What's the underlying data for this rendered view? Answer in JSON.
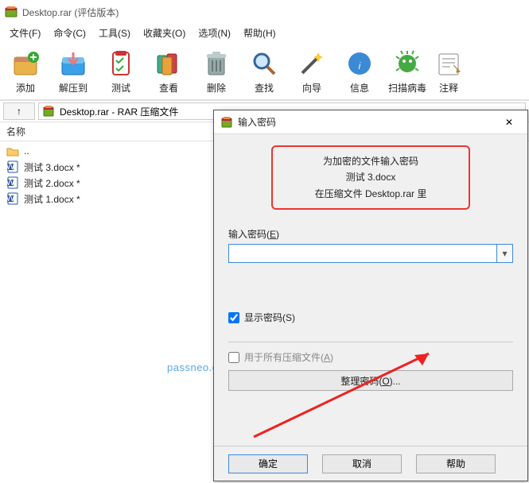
{
  "window": {
    "title": "Desktop.rar (评估版本)"
  },
  "menu": {
    "file": "文件(F)",
    "command": "命令(C)",
    "tools": "工具(S)",
    "favorites": "收藏夹(O)",
    "options": "选项(N)",
    "help": "帮助(H)"
  },
  "toolbar": {
    "add": "添加",
    "extract": "解压到",
    "test": "测试",
    "view": "查看",
    "delete": "删除",
    "find": "查找",
    "wizard": "向导",
    "info": "信息",
    "scan": "扫描病毒",
    "comment": "注释"
  },
  "address": {
    "up": "↑",
    "path": "Desktop.rar - RAR 压缩文件"
  },
  "list": {
    "header_name": "名称",
    "rows": [
      {
        "name": "..",
        "type": "folder"
      },
      {
        "name": "测试 3.docx *",
        "type": "docx"
      },
      {
        "name": "测试 2.docx *",
        "type": "docx"
      },
      {
        "name": "测试 1.docx *",
        "type": "docx"
      }
    ]
  },
  "dialog": {
    "title": "输入密码",
    "msg_line1": "为加密的文件输入密码",
    "msg_line2": "测试 3.docx",
    "msg_line3": "在压缩文件 Desktop.rar 里",
    "field_label_pre": "输入密码(",
    "field_label_key": "E",
    "field_label_post": ")",
    "password_value": "",
    "show_pw_pre": "显示密码(",
    "show_pw_key": "S",
    "show_pw_post": ")",
    "show_pw_checked": true,
    "all_archives_pre": "用于所有压缩文件(",
    "all_archives_key": "A",
    "all_archives_post": ")",
    "all_archives_checked": false,
    "organize_pre": "整理密码(",
    "organize_key": "O",
    "organize_post": ")...",
    "ok": "确定",
    "cancel": "取消",
    "help": "帮助"
  },
  "watermark": "passneo.cn"
}
